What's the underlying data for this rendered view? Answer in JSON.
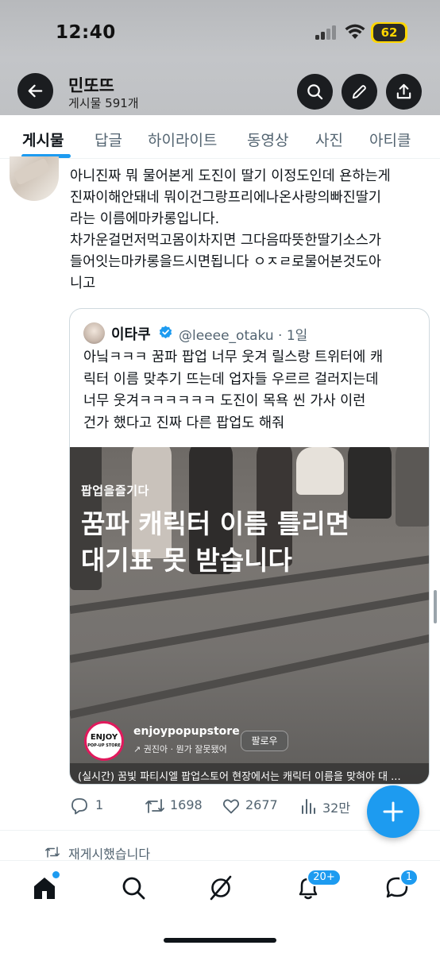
{
  "status_bar": {
    "time": "12:40",
    "battery": "62"
  },
  "header": {
    "name": "민또뜨",
    "post_count": "게시물 591개"
  },
  "tabs": [
    {
      "label": "게시물",
      "active": true
    },
    {
      "label": "답글"
    },
    {
      "label": "하이라이트"
    },
    {
      "label": "동영상"
    },
    {
      "label": "사진"
    },
    {
      "label": "아티클"
    }
  ],
  "post": {
    "lines": [
      "아니진짜 뭐 물어본게 도진이 딸기 이정도인데 욘하는게",
      "진짜이해안돼네 뭐이건그랑프리에나온사랑의빠진딸기",
      "라는 이름에마카롱입니다.",
      "차가운걸먼저먹고몸이차지면 그다음따뜻한딸기소스가",
      "들어잇는마카롱을드시면됩니다 ㅇㅈㄹ로물어본것도아",
      "니고"
    ],
    "quote": {
      "name": "이타쿠",
      "handle": "@leeee_otaku · 1일",
      "lines": [
        "아닠ㅋㅋㅋ 꿈파 팝업 너무 웃겨 릴스랑 트위터에 캐",
        "릭터 이름 맞추기 뜨는데 업자들 우르르 걸러지는데",
        "너무 웃겨ㅋㅋㅋㅋㅋㅋ  도진이 목욕 씬 가사 이런",
        "건가 했다고 진짜 다른 팝업도 해줘"
      ],
      "media": {
        "caption_small": "팝업을즐기다",
        "caption_line1": "꿈파 캐릭터 이름 틀리면",
        "caption_line2": "대기표 못 받습니다",
        "logo_line1": "ENJOY",
        "logo_line2": "POP-UP STORE",
        "account": "enjoypopupstore",
        "account_sub": "↗ 권진아 · 뭔가 잘못됐어",
        "follow": "팔로우",
        "bottom_caption": "(실시간) 꿈빛 파티시엘 팝업스토어 현장에서는 캐릭터 이름을 맞혀야 대 ..."
      }
    },
    "actions": {
      "replies": "1",
      "reposts": "1698",
      "likes": "2677",
      "views": "32만"
    }
  },
  "repost_label": "재게시했습니다",
  "nav": {
    "notifications_badge": "20+",
    "messages_badge": "1"
  },
  "colors": {
    "accent": "#1d9bf0",
    "text": "#0f1419",
    "muted": "#536471"
  }
}
